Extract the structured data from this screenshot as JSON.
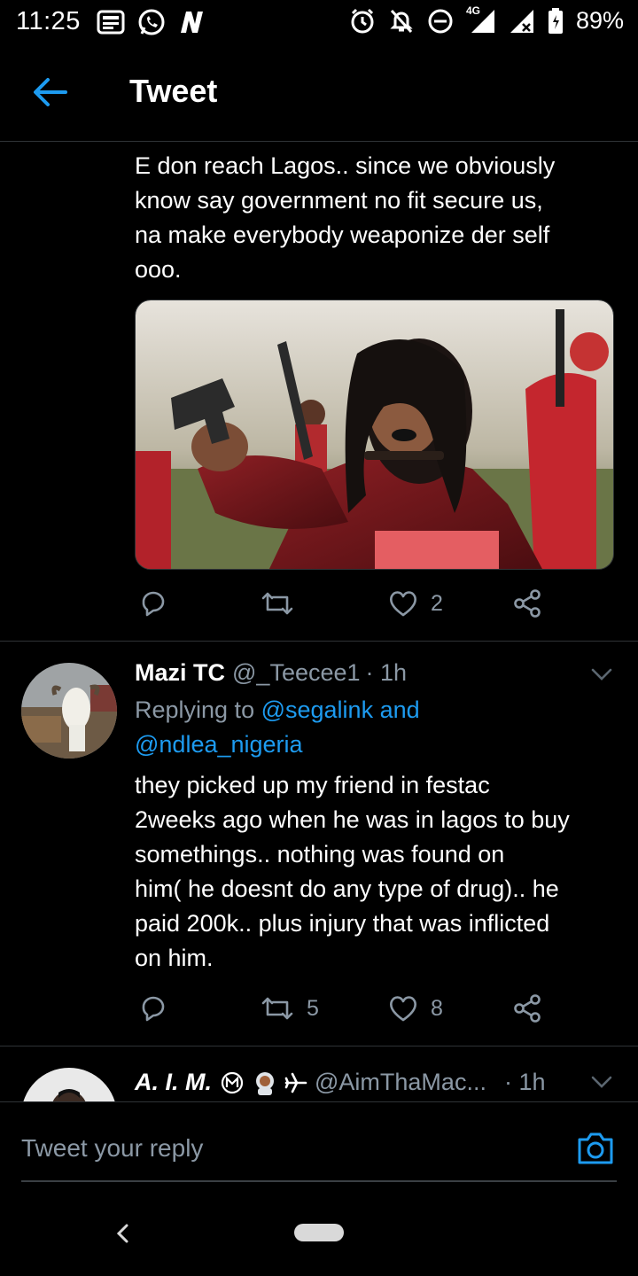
{
  "status_bar": {
    "time": "11:25",
    "network": "4G",
    "battery": "89%",
    "left_icons": [
      "news-app-icon",
      "whatsapp-icon",
      "n-app-icon"
    ],
    "right_icons": [
      "alarm-icon",
      "mute-icon",
      "do-not-disturb-icon",
      "signal-icon",
      "signal-x-icon",
      "battery-icon"
    ]
  },
  "header": {
    "title": "Tweet",
    "back_icon": "arrow-left-icon"
  },
  "tweet1": {
    "text_lines": [
      "E don reach Lagos.. since we obviously",
      "know say government no fit secure us,",
      "na make everybody weaponize der self",
      "ooo."
    ],
    "media": "photo-woman-with-gun",
    "actions": {
      "reply_count": "",
      "retweet_count": "",
      "like_count": "2"
    }
  },
  "tweet2": {
    "name": "Mazi TC",
    "handle": "@_Teecee1",
    "time": "· 1h",
    "replying_prefix": "Replying to ",
    "reply_user1": "@segalink",
    "reply_and": " and",
    "reply_user2": "@ndlea_nigeria",
    "text_lines": [
      "they picked up my friend in festac",
      "2weeks ago when he was in lagos to buy",
      "somethings.. nothing was found on",
      "him( he doesnt do any type of drug).. he",
      "paid 200k.. plus injury that was inflicted",
      "on him."
    ],
    "actions": {
      "reply_count": "",
      "retweet_count": "5",
      "like_count": "8"
    }
  },
  "tweet3": {
    "name": "A. I. M.",
    "handle": "@AimThaMac...",
    "time": "· 1h"
  },
  "compose": {
    "placeholder": "Tweet your reply"
  },
  "colors": {
    "background": "#000000",
    "accent": "#1d9bf0",
    "muted": "#8b98a5",
    "divider": "#2f3336"
  }
}
